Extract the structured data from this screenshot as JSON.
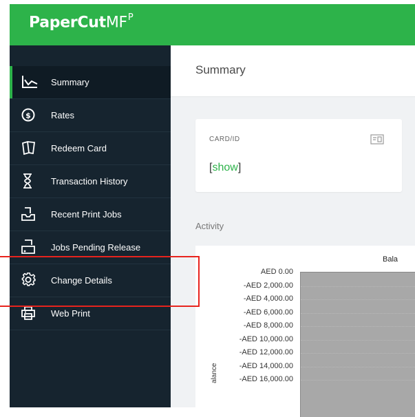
{
  "header": {
    "logo_bold": "PaperCut",
    "logo_light": "MF",
    "logo_mark": "P",
    "brand_color": "#2db34a"
  },
  "sidebar": {
    "items": [
      {
        "label": "Summary",
        "icon": "line-chart-icon",
        "active": true
      },
      {
        "label": "Rates",
        "icon": "dollar-circle-icon"
      },
      {
        "label": "Redeem Card",
        "icon": "cards-icon"
      },
      {
        "label": "Transaction History",
        "icon": "hourglass-icon"
      },
      {
        "label": "Recent Print Jobs",
        "icon": "inbox-tray-icon"
      },
      {
        "label": "Jobs Pending Release",
        "icon": "printer-release-icon"
      },
      {
        "label": "Change Details",
        "icon": "gear-icon"
      },
      {
        "label": "Web Print",
        "icon": "printer-icon"
      }
    ]
  },
  "page": {
    "title": "Summary"
  },
  "card": {
    "label": "CARD/ID",
    "value_open": "[",
    "value_link": "show",
    "value_close": "]",
    "icon": "id-card-icon"
  },
  "activity": {
    "title": "Activity"
  },
  "chart_data": {
    "type": "area",
    "title": "Bala",
    "ylabel": "alance",
    "y_ticks": [
      "AED 0.00",
      "-AED 2,000.00",
      "-AED 4,000.00",
      "-AED 6,000.00",
      "-AED 8,000.00",
      "-AED 10,000.00",
      "-AED 12,000.00",
      "-AED 14,000.00",
      "-AED 16,000.00"
    ],
    "ylim": [
      -16000,
      0
    ],
    "grid": true,
    "fill_color": "#a8a8a8"
  },
  "highlight": {
    "color": "#e8231d",
    "target": "Change Details"
  }
}
